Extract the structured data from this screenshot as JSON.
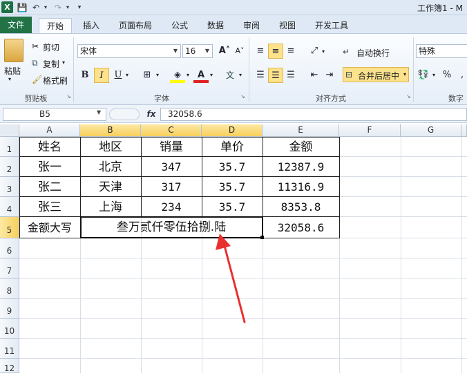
{
  "window": {
    "app_icon": "X",
    "title": "工作簿1 - M",
    "qat": {
      "save": "save-icon",
      "undo": "undo-icon",
      "redo": "redo-icon"
    }
  },
  "tabs": [
    {
      "label": "文件"
    },
    {
      "label": "开始"
    },
    {
      "label": "插入"
    },
    {
      "label": "页面布局"
    },
    {
      "label": "公式"
    },
    {
      "label": "数据"
    },
    {
      "label": "审阅"
    },
    {
      "label": "视图"
    },
    {
      "label": "开发工具"
    }
  ],
  "ribbon": {
    "clipboard": {
      "paste": "粘贴",
      "cut": "剪切",
      "copy": "复制",
      "format_painter": "格式刷",
      "group": "剪贴板"
    },
    "font": {
      "name": "宋体",
      "size": "16",
      "bold": "B",
      "italic": "I",
      "underline": "U",
      "group": "字体"
    },
    "alignment": {
      "wrap": "自动换行",
      "merge": "合并后居中",
      "group": "对齐方式"
    },
    "number": {
      "format": "特殊",
      "percent": "%",
      "group": "数字"
    }
  },
  "formula_bar": {
    "name_box": "B5",
    "fx": "fx",
    "formula": "32058.6"
  },
  "grid": {
    "columns": [
      "A",
      "B",
      "C",
      "D",
      "E",
      "F",
      "G"
    ],
    "rows": [
      "1",
      "2",
      "3",
      "4",
      "5",
      "6",
      "7",
      "8",
      "9",
      "10",
      "11",
      "12"
    ],
    "cells": {
      "r1": [
        "姓名",
        "地区",
        "销量",
        "单价",
        "金额"
      ],
      "r2": [
        "张一",
        "北京",
        "347",
        "35.7",
        "12387.9"
      ],
      "r3": [
        "张二",
        "天津",
        "317",
        "35.7",
        "11316.9"
      ],
      "r4": [
        "张三",
        "上海",
        "234",
        "35.7",
        "8353.8"
      ],
      "r5": {
        "a": "金额大写",
        "bc": "叁万贰仟零伍拾捌.陆",
        "e": "32058.6"
      }
    }
  },
  "colors": {
    "accent": "#217346",
    "selection": "#f7cf5d",
    "arrow": "#e8312f"
  }
}
